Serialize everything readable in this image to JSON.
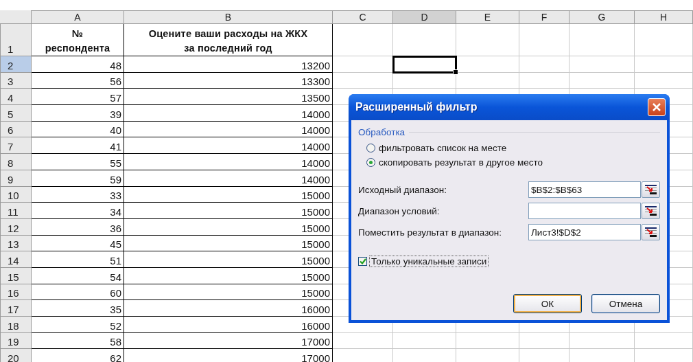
{
  "columns": [
    {
      "label": "A",
      "selected": false
    },
    {
      "label": "B",
      "selected": false
    },
    {
      "label": "C",
      "selected": false
    },
    {
      "label": "D",
      "selected": true
    },
    {
      "label": "E",
      "selected": false
    },
    {
      "label": "F",
      "selected": false
    },
    {
      "label": "G",
      "selected": false
    },
    {
      "label": "H",
      "selected": false
    }
  ],
  "header_row": {
    "number": "1",
    "cells": [
      "№\nреспондента",
      "Оцените ваши расходы на ЖКХ\nза последний год"
    ]
  },
  "rows": [
    {
      "number": "2",
      "selected": true,
      "cells": [
        "48",
        "13200"
      ]
    },
    {
      "number": "3",
      "selected": false,
      "cells": [
        "56",
        "13300"
      ]
    },
    {
      "number": "4",
      "selected": false,
      "cells": [
        "57",
        "13500"
      ]
    },
    {
      "number": "5",
      "selected": false,
      "cells": [
        "39",
        "14000"
      ]
    },
    {
      "number": "6",
      "selected": false,
      "cells": [
        "40",
        "14000"
      ]
    },
    {
      "number": "7",
      "selected": false,
      "cells": [
        "41",
        "14000"
      ]
    },
    {
      "number": "8",
      "selected": false,
      "cells": [
        "55",
        "14000"
      ]
    },
    {
      "number": "9",
      "selected": false,
      "cells": [
        "59",
        "14000"
      ]
    },
    {
      "number": "10",
      "selected": false,
      "cells": [
        "33",
        "15000"
      ]
    },
    {
      "number": "11",
      "selected": false,
      "cells": [
        "34",
        "15000"
      ]
    },
    {
      "number": "12",
      "selected": false,
      "cells": [
        "36",
        "15000"
      ]
    },
    {
      "number": "13",
      "selected": false,
      "cells": [
        "45",
        "15000"
      ]
    },
    {
      "number": "14",
      "selected": false,
      "cells": [
        "51",
        "15000"
      ]
    },
    {
      "number": "15",
      "selected": false,
      "cells": [
        "54",
        "15000"
      ]
    },
    {
      "number": "16",
      "selected": false,
      "cells": [
        "60",
        "15000"
      ]
    },
    {
      "number": "17",
      "selected": false,
      "cells": [
        "35",
        "16000"
      ]
    },
    {
      "number": "18",
      "selected": false,
      "cells": [
        "52",
        "16000"
      ]
    },
    {
      "number": "19",
      "selected": false,
      "cells": [
        "58",
        "17000"
      ]
    },
    {
      "number": "20",
      "selected": false,
      "cells": [
        "62",
        "17000"
      ]
    }
  ],
  "dialog": {
    "title": "Расширенный фильтр",
    "group_label": "Обработка",
    "options": [
      {
        "label": "фильтровать список на месте",
        "selected": false
      },
      {
        "label": "скопировать результат в другое место",
        "selected": true
      }
    ],
    "fields": [
      {
        "label": "Исходный диапазон:",
        "value": "$B$2:$B$63"
      },
      {
        "label": "Диапазон условий:"
      },
      {
        "label": "Поместить результат в диапазон:",
        "value": "Лист3!$D$2"
      }
    ],
    "checkbox": {
      "label": "Только уникальные записи",
      "checked": true
    },
    "buttons": [
      {
        "label": "ОК",
        "default": true
      },
      {
        "label": "Отмена",
        "default": false
      }
    ]
  }
}
